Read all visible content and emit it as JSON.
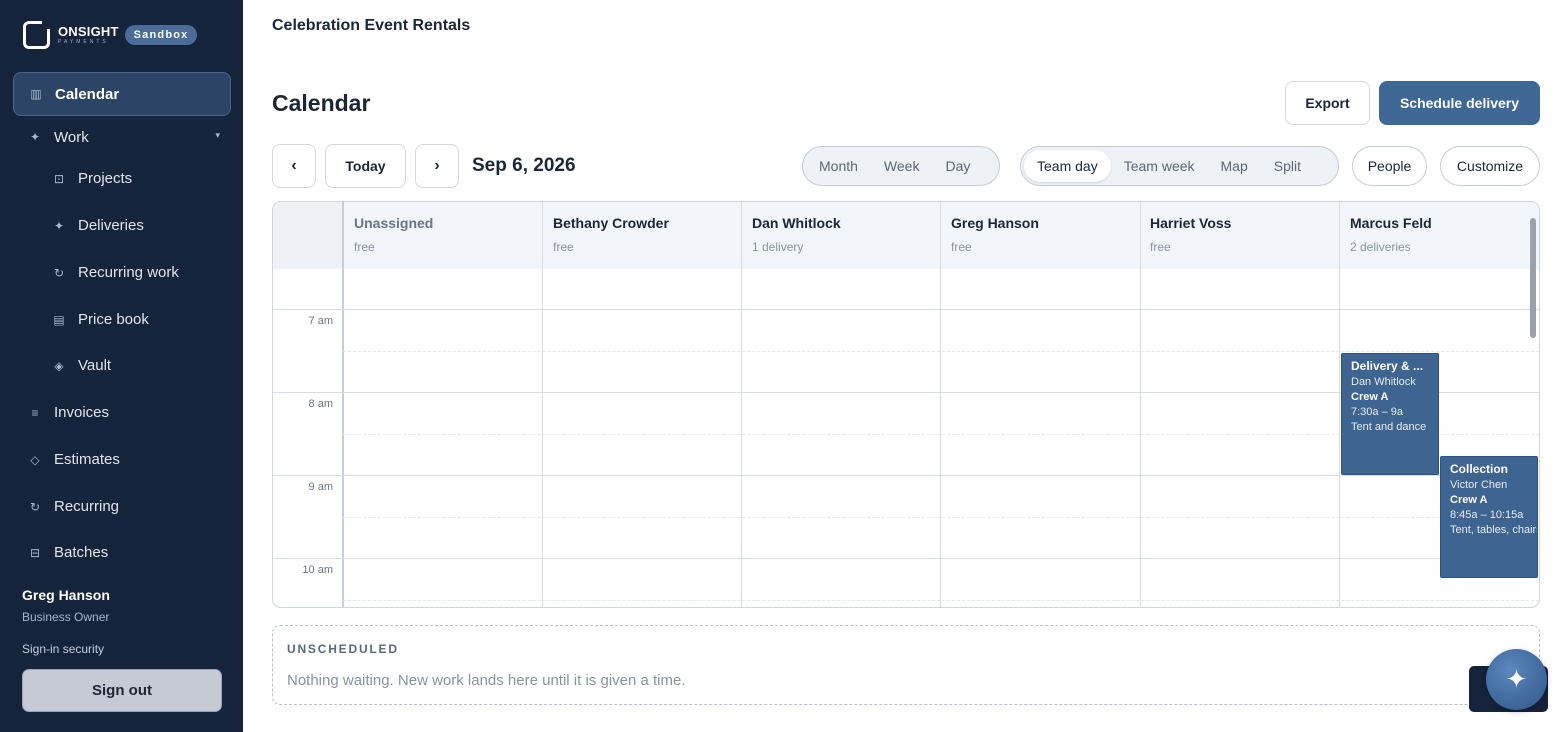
{
  "brand": {
    "name": "ONSIGHT",
    "sub": "PAYMENTS",
    "env_badge": "Sandbox"
  },
  "sidebar": {
    "items": [
      {
        "label": "Calendar",
        "icon": "calendar-icon"
      },
      {
        "label": "Work",
        "icon": "sparkle-icon"
      },
      {
        "label": "Projects",
        "icon": "projects-icon"
      },
      {
        "label": "Deliveries",
        "icon": "sparkle-icon"
      },
      {
        "label": "Recurring work",
        "icon": "refresh-icon"
      },
      {
        "label": "Price book",
        "icon": "book-icon"
      },
      {
        "label": "Vault",
        "icon": "diamond-icon"
      },
      {
        "label": "Invoices",
        "icon": "list-icon"
      },
      {
        "label": "Estimates",
        "icon": "diamond-outline-icon"
      },
      {
        "label": "Recurring",
        "icon": "refresh-icon"
      },
      {
        "label": "Batches",
        "icon": "batches-icon"
      }
    ],
    "user": {
      "name": "Greg Hanson",
      "role": "Business Owner"
    },
    "signin_security": "Sign-in security",
    "signout": "Sign out"
  },
  "header": {
    "org": "Celebration Event Rentals",
    "title": "Calendar",
    "export": "Export",
    "schedule": "Schedule delivery"
  },
  "toolbar": {
    "prev": "‹",
    "today": "Today",
    "next": "›",
    "date": "Sep 6, 2026",
    "views": [
      "Month",
      "Week",
      "Day"
    ],
    "team_views": [
      "Team day",
      "Team week",
      "Map",
      "Split"
    ],
    "selected_team_view": "Team day",
    "people": "People",
    "customize": "Customize"
  },
  "calendar": {
    "columns": [
      {
        "name": "Unassigned",
        "count": "free"
      },
      {
        "name": "Bethany Crowder",
        "count": "free"
      },
      {
        "name": "Dan Whitlock",
        "count": "1 delivery"
      },
      {
        "name": "Greg Hanson",
        "count": "free"
      },
      {
        "name": "Harriet Voss",
        "count": "free"
      },
      {
        "name": "Marcus Feld",
        "count": "2 deliveries"
      }
    ],
    "times": [
      "7 am",
      "8 am",
      "9 am",
      "10 am"
    ],
    "events": [
      {
        "title": "Delivery & ...",
        "customer": "Dan Whitlock",
        "crew": "Crew A",
        "time": "7:30a – 9a",
        "note": "Tent and dance"
      },
      {
        "title": "Collection",
        "customer": "Victor Chen",
        "crew": "Crew A",
        "time": "8:45a – 10:15a",
        "note": "Tent, tables, chairs"
      }
    ]
  },
  "unscheduled": {
    "title": "UNSCHEDULED",
    "message": "Nothing waiting. New work lands here until it is given a time."
  },
  "colors": {
    "sidebar": "#15233b",
    "accent": "#3f6896",
    "event": "#3e6492"
  }
}
